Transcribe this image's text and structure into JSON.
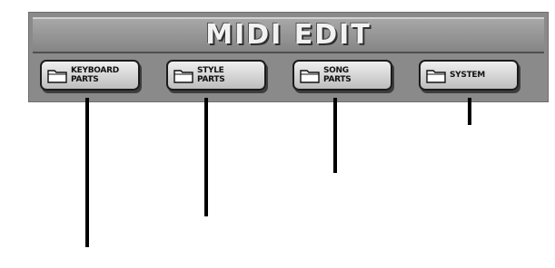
{
  "window": {
    "title": "MIDI EDIT"
  },
  "buttons": [
    {
      "label": "KEYBOARD\nPARTS",
      "icon": "folder-icon"
    },
    {
      "label": "STYLE\nPARTS",
      "icon": "folder-icon"
    },
    {
      "label": "SONG\nPARTS",
      "icon": "folder-icon"
    },
    {
      "label": "SYSTEM",
      "icon": "folder-icon"
    }
  ]
}
